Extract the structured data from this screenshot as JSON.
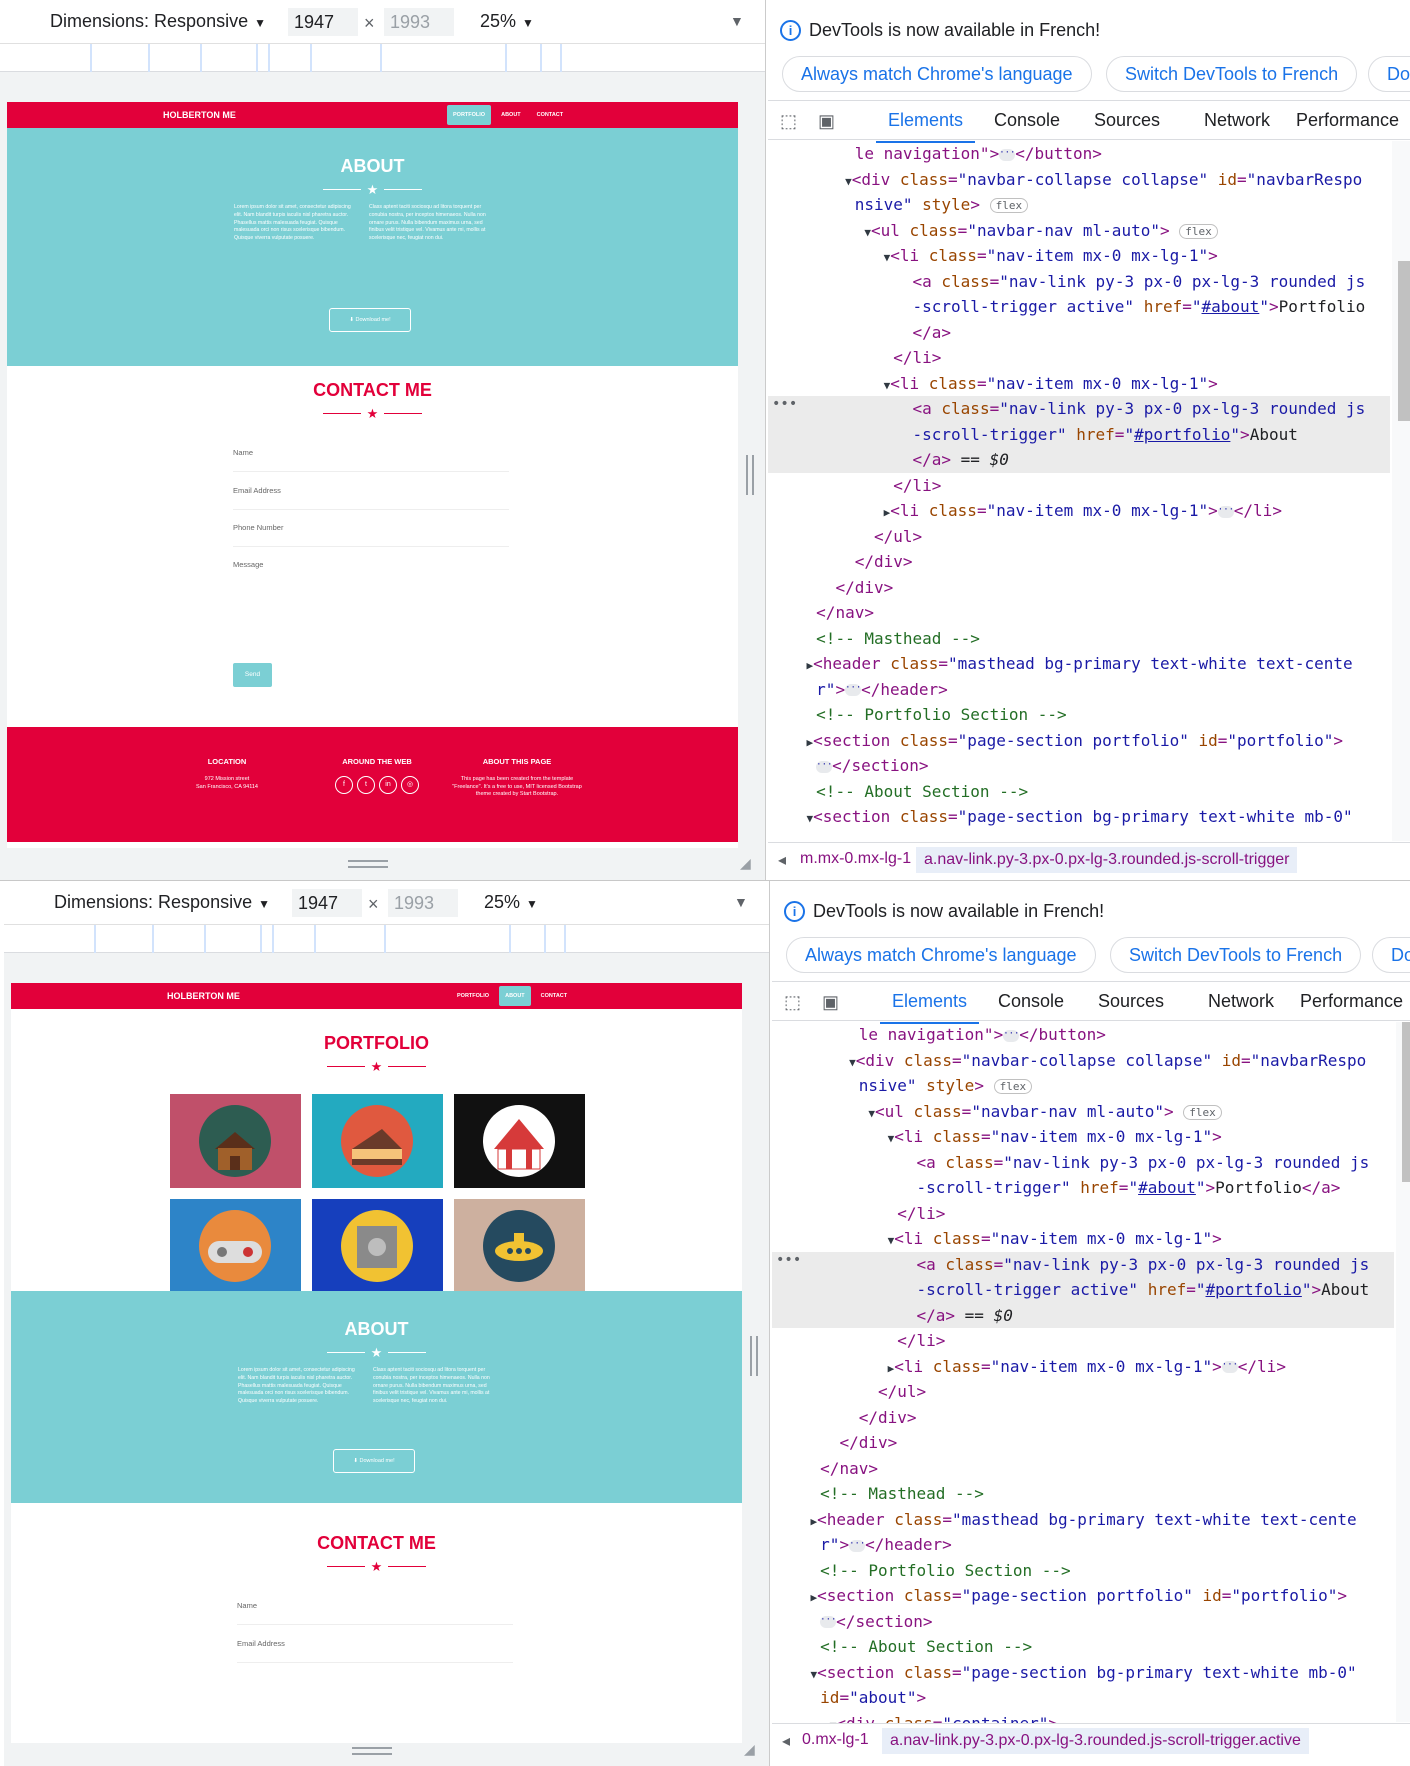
{
  "toolbar": {
    "dim_label": "Dimensions: Responsive",
    "width": "1947",
    "height": "1993",
    "zoom": "25%"
  },
  "site": {
    "brand": "HOLBERTON ME",
    "nav": [
      "PORTFOLIO",
      "ABOUT",
      "CONTACT"
    ],
    "about_title": "ABOUT",
    "about_left": "Lorem ipsum dolor sit amet, consectetur adipiscing elit. Nam blandit turpis iaculis nisl pharetra auctor. Phasellus mattis malesuada feugiat. Quisque malesuada orci non risus scelerisque bibendum. Quisque viverra vulputate posuere.",
    "about_right": "Class aptent taciti sociosqu ad litora torquent per conubia nostra, per inceptos himenaeos. Nulla non ornare purus. Nulla bibendum maximus urna, sed finibus velit tristique vel. Vivamus ante mi, mollis at scelerisque nec, feugiat non dui.",
    "download": "Download me!",
    "contact_title": "CONTACT ME",
    "fields": [
      "Name",
      "Email Address",
      "Phone Number",
      "Message"
    ],
    "send": "Send",
    "portfolio_title": "PORTFOLIO",
    "footer": {
      "location_title": "LOCATION",
      "location_line1": "972 Mission street",
      "location_line2": "San Francisco, CA 94114",
      "web_title": "AROUND THE WEB",
      "about_title": "ABOUT THIS PAGE",
      "about_text": "This page has been created from the template \"Freelance\". It's a free to use, MIT licensed Bootstrap theme created by Start Bootstrap."
    }
  },
  "devtools": {
    "info": "DevTools is now available in French!",
    "btn_match": "Always match Chrome's language",
    "btn_switch": "Switch DevTools to French",
    "btn_dont": "Don't show again",
    "tabs": [
      "Elements",
      "Console",
      "Sources",
      "Network",
      "Performance"
    ],
    "crumb_top_1": "m.mx-0.mx-lg-1",
    "crumb_top_2": "a.nav-link.py-3.px-0.px-lg-3.rounded.js-scroll-trigger",
    "crumb_bot_1": "0.mx-lg-1",
    "crumb_bot_2": "a.nav-link.py-3.px-0.px-lg-3.rounded.js-scroll-trigger.active"
  }
}
